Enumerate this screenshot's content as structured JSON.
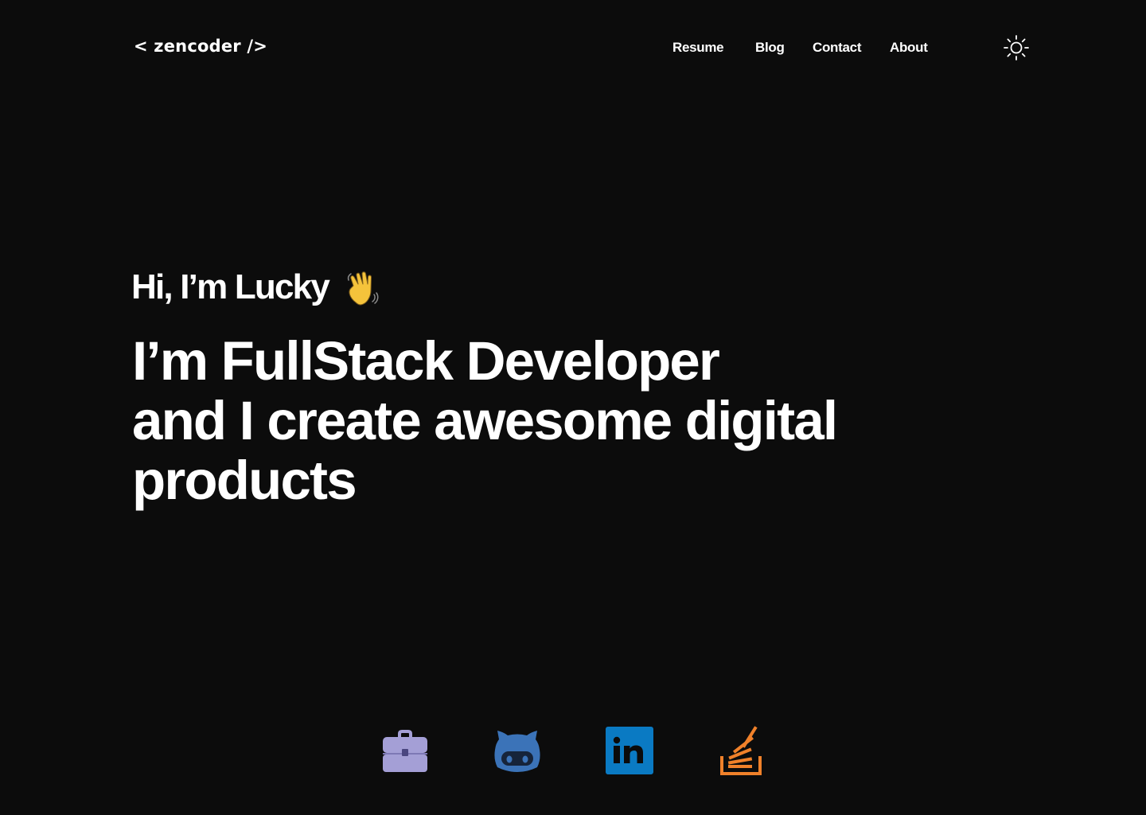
{
  "header": {
    "logo": "< zencoder />",
    "nav": [
      {
        "label": "Resume"
      },
      {
        "label": "Blog"
      },
      {
        "label": "Contact"
      },
      {
        "label": "About"
      }
    ],
    "theme_toggle_icon": "sun-icon"
  },
  "hero": {
    "greeting": "Hi, I’m Lucky",
    "greeting_icon": "waving-hand-icon",
    "headline_lines": [
      "I’m FullStack Developer",
      "and I create awesome digital",
      "products"
    ]
  },
  "socials": [
    {
      "icon": "briefcase-icon",
      "color": "#a49fd6"
    },
    {
      "icon": "github-icon",
      "color": "#3b73b8"
    },
    {
      "icon": "linkedin-icon",
      "color": "#0a7ac3"
    },
    {
      "icon": "stackoverflow-icon",
      "color": "#f0812a"
    }
  ],
  "colors": {
    "background": "#0c0c0c",
    "text": "#ffffff"
  }
}
